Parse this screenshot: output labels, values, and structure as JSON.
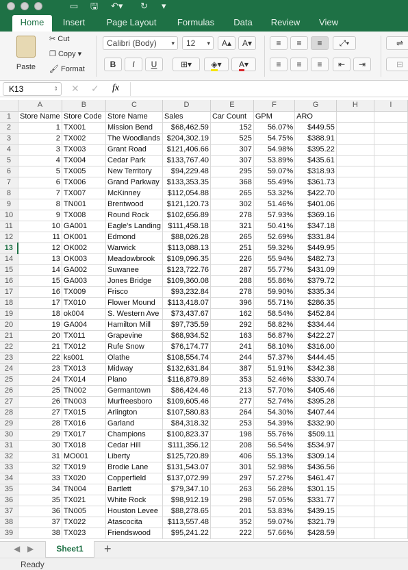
{
  "tabs": [
    "Home",
    "Insert",
    "Page Layout",
    "Formulas",
    "Data",
    "Review",
    "View"
  ],
  "ribbon": {
    "paste": "Paste",
    "cut": "Cut",
    "copy": "Copy",
    "format": "Format",
    "font": "Calibri (Body)",
    "size": "12",
    "bold": "B",
    "italic": "I",
    "underline": "U"
  },
  "formula": {
    "namebox": "K13",
    "fx": "fx",
    "value": ""
  },
  "columns": [
    "A",
    "B",
    "C",
    "D",
    "E",
    "F",
    "G",
    "H",
    "I"
  ],
  "headers": [
    "Store Name",
    "Store Code",
    "Store Name",
    "Sales",
    "Car Count",
    "GPM",
    "ARO"
  ],
  "rows": [
    [
      "1",
      "TX001",
      "Mission Bend",
      "$68,462.59",
      "152",
      "56.07%",
      "$449.55"
    ],
    [
      "2",
      "TX002",
      "The Woodlands",
      "$204,302.19",
      "525",
      "54.75%",
      "$388.91"
    ],
    [
      "3",
      "TX003",
      "Grant Road",
      "$121,406.66",
      "307",
      "54.98%",
      "$395.22"
    ],
    [
      "4",
      "TX004",
      "Cedar Park",
      "$133,767.40",
      "307",
      "53.89%",
      "$435.61"
    ],
    [
      "5",
      "TX005",
      "New Territory",
      "$94,229.48",
      "295",
      "59.07%",
      "$318.93"
    ],
    [
      "6",
      "TX006",
      "Grand Parkway",
      "$133,353.35",
      "368",
      "55.49%",
      "$361.73"
    ],
    [
      "7",
      "TX007",
      "McKinney",
      "$112,054.88",
      "265",
      "53.32%",
      "$422.70"
    ],
    [
      "8",
      "TN001",
      "Brentwood",
      "$121,120.73",
      "302",
      "51.46%",
      "$401.06"
    ],
    [
      "9",
      "TX008",
      "Round Rock",
      "$102,656.89",
      "278",
      "57.93%",
      "$369.16"
    ],
    [
      "10",
      "GA001",
      "Eagle's Landing",
      "$111,458.18",
      "321",
      "50.41%",
      "$347.18"
    ],
    [
      "11",
      "OK001",
      "Edmond",
      "$88,026.28",
      "265",
      "52.69%",
      "$331.84"
    ],
    [
      "12",
      "OK002",
      "Warwick",
      "$113,088.13",
      "251",
      "59.32%",
      "$449.95"
    ],
    [
      "13",
      "OK003",
      "Meadowbrook",
      "$109,096.35",
      "226",
      "55.94%",
      "$482.73"
    ],
    [
      "14",
      "GA002",
      "Suwanee",
      "$123,722.76",
      "287",
      "55.77%",
      "$431.09"
    ],
    [
      "15",
      "GA003",
      "Jones Bridge",
      "$109,360.08",
      "288",
      "55.86%",
      "$379.72"
    ],
    [
      "16",
      "TX009",
      "Frisco",
      "$93,232.84",
      "278",
      "59.90%",
      "$335.34"
    ],
    [
      "17",
      "TX010",
      "Flower Mound",
      "$113,418.07",
      "396",
      "55.71%",
      "$286.35"
    ],
    [
      "18",
      "ok004",
      "S. Western Ave",
      "$73,437.67",
      "162",
      "58.54%",
      "$452.84"
    ],
    [
      "19",
      "GA004",
      "Hamilton Mill",
      "$97,735.59",
      "292",
      "58.82%",
      "$334.44"
    ],
    [
      "20",
      "TX011",
      "Grapevine",
      "$68,934.52",
      "163",
      "56.87%",
      "$422.27"
    ],
    [
      "21",
      "TX012",
      "Rufe Snow",
      "$76,174.77",
      "241",
      "58.10%",
      "$316.00"
    ],
    [
      "22",
      "ks001",
      "Olathe",
      "$108,554.74",
      "244",
      "57.37%",
      "$444.45"
    ],
    [
      "23",
      "TX013",
      "Midway",
      "$132,631.84",
      "387",
      "51.91%",
      "$342.38"
    ],
    [
      "24",
      "TX014",
      "Plano",
      "$116,879.89",
      "353",
      "52.46%",
      "$330.74"
    ],
    [
      "25",
      "TN002",
      "Germantown",
      "$86,424.46",
      "213",
      "57.70%",
      "$405.46"
    ],
    [
      "26",
      "TN003",
      "Murfreesboro",
      "$109,605.46",
      "277",
      "52.74%",
      "$395.28"
    ],
    [
      "27",
      "TX015",
      "Arlington",
      "$107,580.83",
      "264",
      "54.30%",
      "$407.44"
    ],
    [
      "28",
      "TX016",
      "Garland",
      "$84,318.32",
      "253",
      "54.39%",
      "$332.90"
    ],
    [
      "29",
      "TX017",
      "Champions",
      "$100,823.37",
      "198",
      "55.76%",
      "$509.11"
    ],
    [
      "30",
      "TX018",
      "Cedar Hill",
      "$111,356.12",
      "208",
      "56.54%",
      "$534.97"
    ],
    [
      "31",
      "MO001",
      "Liberty",
      "$125,720.89",
      "406",
      "55.13%",
      "$309.14"
    ],
    [
      "32",
      "TX019",
      "Brodie Lane",
      "$131,543.07",
      "301",
      "52.98%",
      "$436.56"
    ],
    [
      "33",
      "TX020",
      "Copperfield",
      "$137,072.99",
      "297",
      "57.27%",
      "$461.47"
    ],
    [
      "34",
      "TN004",
      "Bartlett",
      "$79,347.10",
      "263",
      "56.28%",
      "$301.15"
    ],
    [
      "35",
      "TX021",
      "White Rock",
      "$98,912.19",
      "298",
      "57.05%",
      "$331.77"
    ],
    [
      "36",
      "TN005",
      "Houston Levee",
      "$88,278.65",
      "201",
      "53.83%",
      "$439.15"
    ],
    [
      "37",
      "TX022",
      "Atascocita",
      "$113,557.48",
      "352",
      "59.07%",
      "$321.79"
    ],
    [
      "38",
      "TX023",
      "Friendswood",
      "$95,241.22",
      "222",
      "57.66%",
      "$428.59"
    ]
  ],
  "sheet": {
    "name": "Sheet1",
    "add": "+"
  },
  "status": "Ready"
}
